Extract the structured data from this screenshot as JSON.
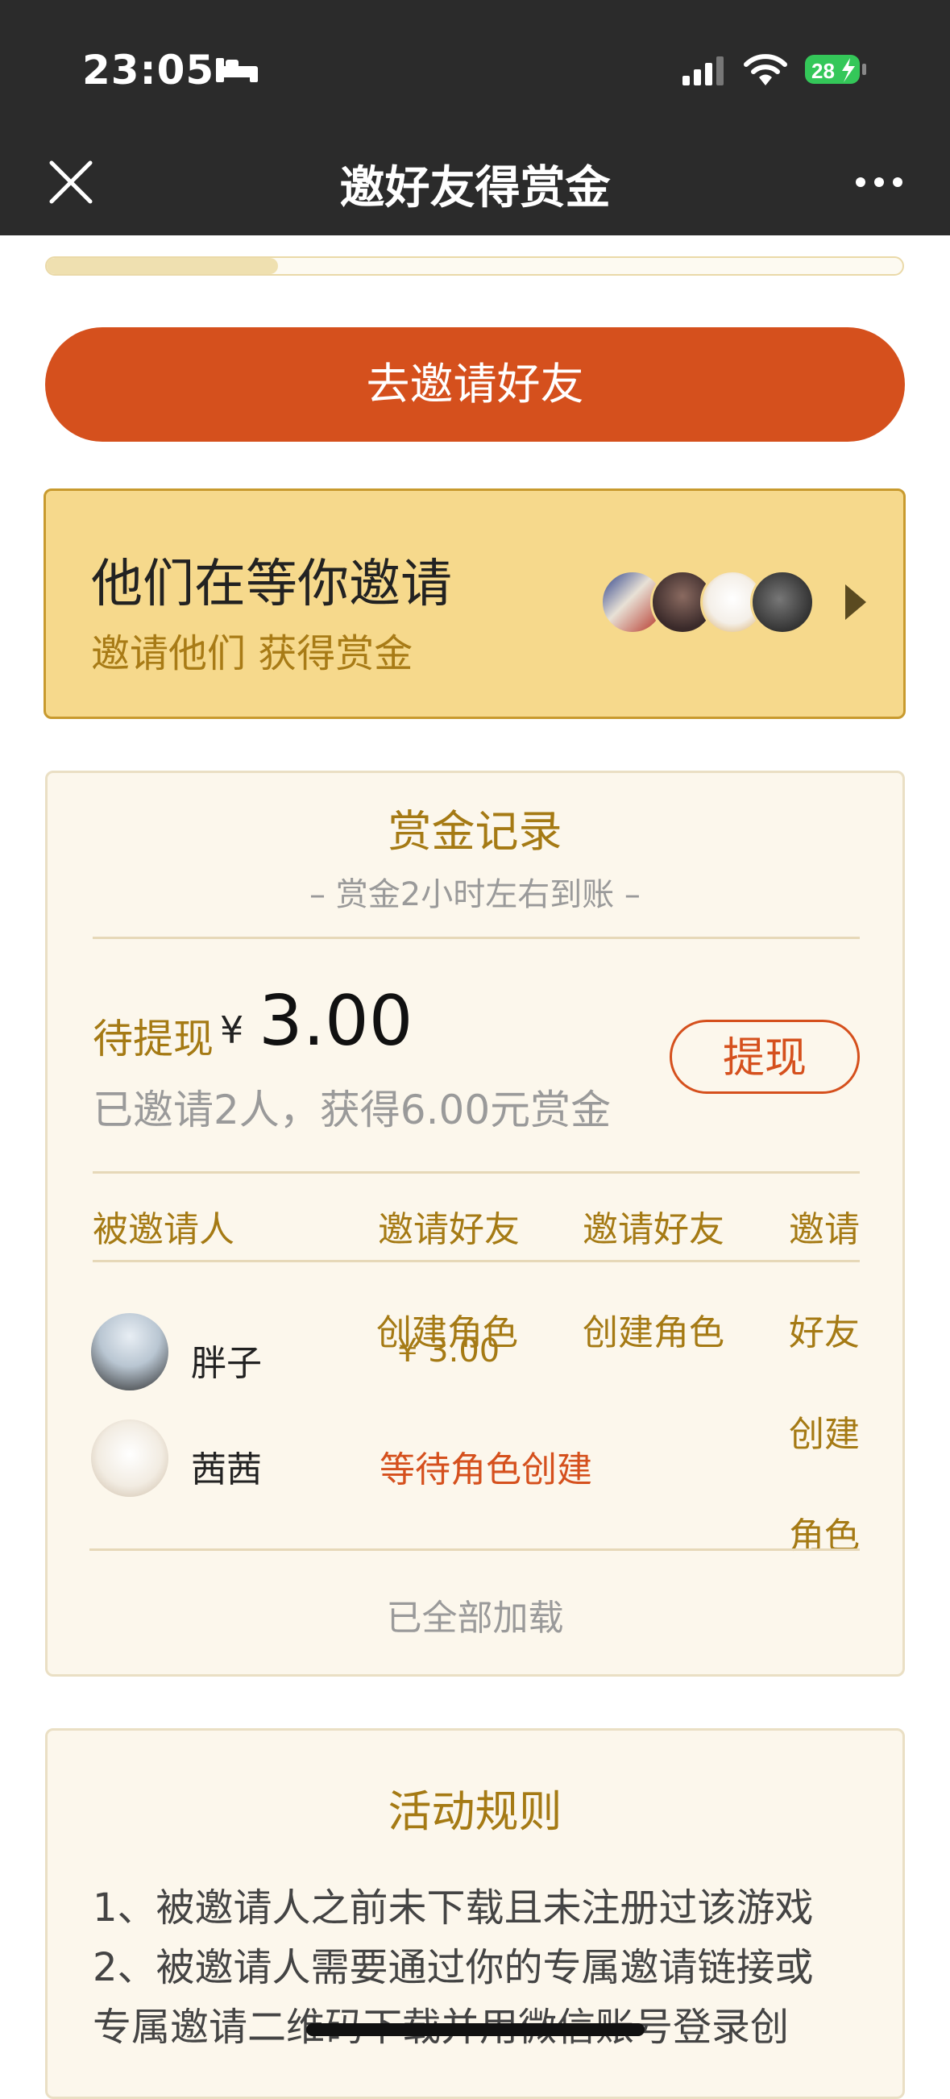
{
  "status_bar": {
    "time": "23:05",
    "battery": "28"
  },
  "nav": {
    "title": "邀好友得赏金",
    "close_icon": "close-icon",
    "more_icon": "more-icon"
  },
  "progress": {
    "fill_fraction": 0.27
  },
  "invite_button": {
    "label": "去邀请好友"
  },
  "waiting_banner": {
    "title": "他们在等你邀请",
    "subtitle": "邀请他们 获得赏金"
  },
  "record": {
    "title": "赏金记录",
    "subtitle": "– 赏金2小时左右到账 –",
    "pending_label": "待提现",
    "currency": "¥",
    "amount": "3.00",
    "summary": "已邀请2人，获得6.00元赏金",
    "withdraw_label": "提现",
    "headers": [
      "被邀请人",
      "邀请好友",
      "邀请好友",
      "邀请"
    ],
    "rows": [
      {
        "name": "胖子",
        "status1": "创建角色",
        "reward": "¥  3.00",
        "status2": "创建角色",
        "status3": "好友"
      },
      {
        "name": "茜茜",
        "status": "等待角色创建",
        "status3": "创建"
      }
    ],
    "col4_extra": "角色",
    "loaded_text": "已全部加载"
  },
  "rules": {
    "title": "活动规则",
    "lines": [
      "1、被邀请人之前未下载且未注册过该游戏",
      "2、被邀请人需要通过你的专属邀请链接或",
      "专属邀请二维码下载并用微信账号登录创"
    ]
  },
  "colors": {
    "accent": "#d5501d",
    "gold": "#a57a14",
    "banner": "#f6d98c"
  }
}
